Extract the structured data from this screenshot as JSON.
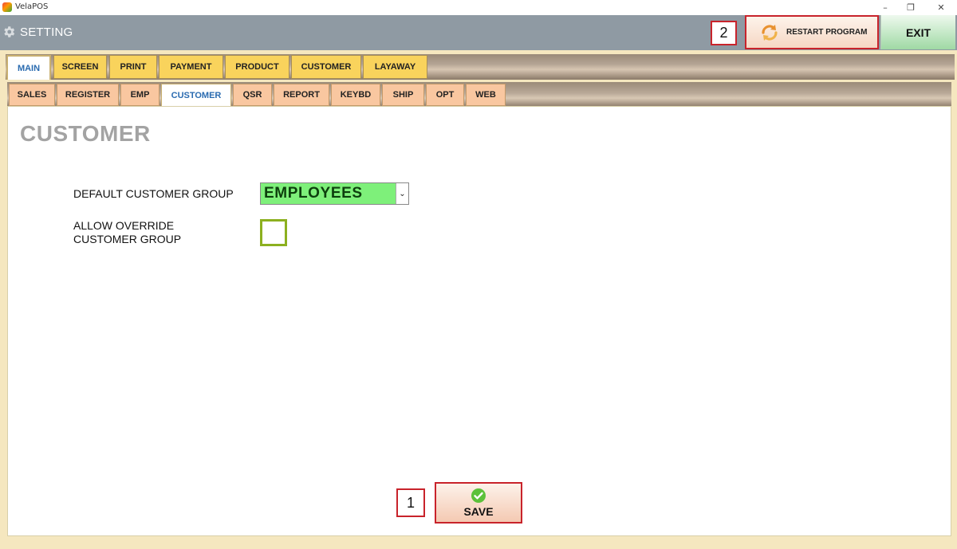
{
  "window": {
    "app_title": "VelaPOS",
    "minimize_glyph": "–",
    "restore_glyph": "❐",
    "close_glyph": "✕"
  },
  "header": {
    "title": "SETTING",
    "icon": "gear-icon",
    "restart_label": "RESTART PROGRAM",
    "exit_label": "EXIT",
    "restart_callout": "2"
  },
  "main_tabs": [
    {
      "label": "MAIN",
      "active": true
    },
    {
      "label": "SCREEN",
      "active": false
    },
    {
      "label": "PRINT",
      "active": false
    },
    {
      "label": "PAYMENT",
      "active": false
    },
    {
      "label": "PRODUCT",
      "active": false
    },
    {
      "label": "CUSTOMER",
      "active": false
    },
    {
      "label": "LAYAWAY",
      "active": false
    }
  ],
  "sub_tabs": [
    {
      "label": "SALES",
      "active": false
    },
    {
      "label": "REGISTER",
      "active": false
    },
    {
      "label": "EMP",
      "active": false
    },
    {
      "label": "CUSTOMER",
      "active": true
    },
    {
      "label": "QSR",
      "active": false
    },
    {
      "label": "REPORT",
      "active": false
    },
    {
      "label": "KEYBD",
      "active": false
    },
    {
      "label": "SHIP",
      "active": false
    },
    {
      "label": "OPT",
      "active": false
    },
    {
      "label": "WEB",
      "active": false
    }
  ],
  "page": {
    "title": "CUSTOMER",
    "default_group_label": "DEFAULT CUSTOMER GROUP",
    "default_group_value": "EMPLOYEES",
    "allow_override_line1": "ALLOW OVERRIDE",
    "allow_override_line2": "CUSTOMER GROUP",
    "allow_override_checked": false
  },
  "footer": {
    "save_label": "SAVE",
    "save_callout": "1"
  },
  "colors": {
    "header_bg": "#8f9aa3",
    "callout_border": "#c8232b",
    "select_bg": "#7ef07a",
    "main_tab_bg": "#f9d35c",
    "sub_tab_bg": "#f9c7a0",
    "checkbox_border": "#8cb01f"
  }
}
